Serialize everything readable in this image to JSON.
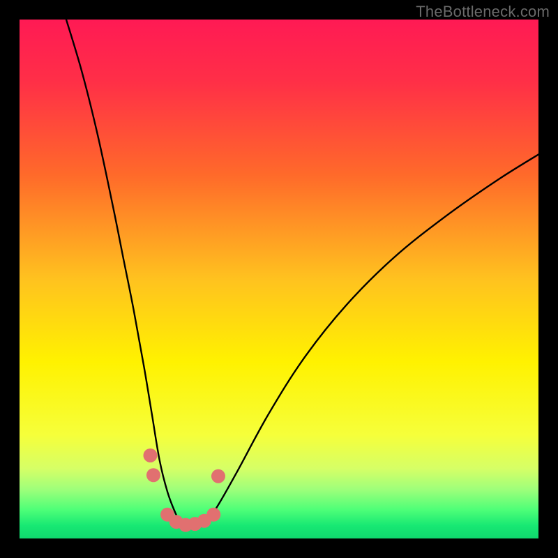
{
  "watermark": "TheBottleneck.com",
  "chart_data": {
    "type": "line",
    "title": "",
    "xlabel": "",
    "ylabel": "",
    "xlim": [
      0,
      100
    ],
    "ylim": [
      0,
      100
    ],
    "gradient_stops": [
      {
        "offset": 0.0,
        "color": "#ff1a54"
      },
      {
        "offset": 0.12,
        "color": "#ff2f47"
      },
      {
        "offset": 0.3,
        "color": "#ff6a2a"
      },
      {
        "offset": 0.5,
        "color": "#ffc21f"
      },
      {
        "offset": 0.66,
        "color": "#fff200"
      },
      {
        "offset": 0.8,
        "color": "#f6ff3a"
      },
      {
        "offset": 0.865,
        "color": "#d6ff66"
      },
      {
        "offset": 0.905,
        "color": "#9fff7a"
      },
      {
        "offset": 0.945,
        "color": "#4dff78"
      },
      {
        "offset": 0.975,
        "color": "#18e873"
      },
      {
        "offset": 1.0,
        "color": "#0fd86e"
      }
    ],
    "series": [
      {
        "name": "bottleneck-curve",
        "x": [
          9,
          12,
          15,
          18,
          20,
          22,
          24,
          25.5,
          27,
          28.5,
          30,
          31,
          32,
          33,
          34,
          36,
          38,
          42,
          48,
          55,
          63,
          72,
          82,
          92,
          100
        ],
        "y": [
          100,
          90,
          78,
          64,
          54,
          44,
          33,
          24,
          15,
          9,
          5,
          3.2,
          2.6,
          2.5,
          2.7,
          3.6,
          6,
          13,
          24,
          35,
          45,
          54,
          62,
          69,
          74
        ]
      }
    ],
    "markers": {
      "name": "highlight-dots",
      "color": "#e17070",
      "radius": 10,
      "points": [
        {
          "x": 25.2,
          "y": 16.0
        },
        {
          "x": 25.8,
          "y": 12.2
        },
        {
          "x": 28.5,
          "y": 4.6
        },
        {
          "x": 30.2,
          "y": 3.2
        },
        {
          "x": 32.0,
          "y": 2.6
        },
        {
          "x": 33.8,
          "y": 2.8
        },
        {
          "x": 35.6,
          "y": 3.4
        },
        {
          "x": 37.4,
          "y": 4.6
        },
        {
          "x": 38.3,
          "y": 12.0
        }
      ]
    }
  }
}
